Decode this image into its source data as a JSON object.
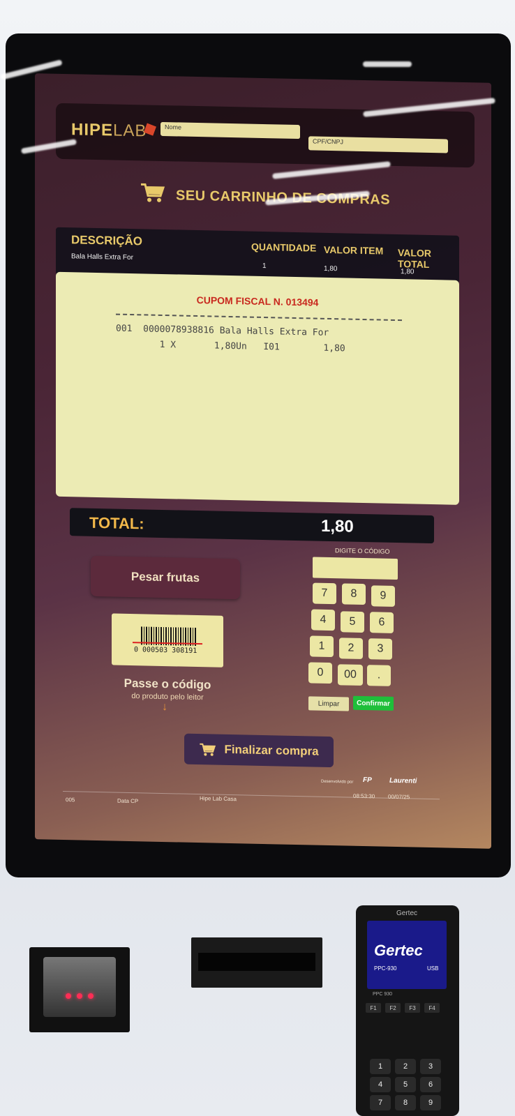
{
  "header": {
    "logo_main": "HIPE",
    "logo_sub": "LAB",
    "name_label": "Nome",
    "cpf_label": "CPF/CNPJ"
  },
  "cart": {
    "title": "SEU CARRINHO DE COMPRAS",
    "icon": "shopping-cart-icon"
  },
  "table": {
    "headers": {
      "description": "DESCRIÇÃO",
      "quantity": "QUANTIDADE",
      "item_value": "VALOR ITEM",
      "total_value": "VALOR TOTAL"
    },
    "row": {
      "description": "Bala Halls Extra For",
      "quantity": "1",
      "item_value": "1,80",
      "total_value": "1,80"
    }
  },
  "receipt": {
    "title": "CUPOM FISCAL N. 013494",
    "line1": "001  0000078938816 Bala Halls Extra For",
    "line2": "        1 X       1,80Un   I01        1,80"
  },
  "total": {
    "label": "TOTAL:",
    "value": "1,80"
  },
  "actions": {
    "pesar_label": "Pesar frutas",
    "barcode_number": "0 000503 308191",
    "scan_title": "Passe o código",
    "scan_subtitle": "do produto pelo leitor",
    "finalize_label": "Finalizar compra"
  },
  "keypad": {
    "label": "DIGITE O CÓDIGO",
    "keys": [
      "7",
      "8",
      "9",
      "4",
      "5",
      "6",
      "1",
      "2",
      "3",
      "0",
      "00",
      "."
    ],
    "clear_label": "Limpar",
    "confirm_label": "Confirmar"
  },
  "footer": {
    "developed_by": "Desenvolvido por",
    "brand1": "FP",
    "brand2": "Laurenti",
    "code": "005",
    "data_label": "Data CP",
    "store": "Hipe Lab Casa",
    "time": "08:53:30",
    "date": "00/07/25"
  },
  "pinpad": {
    "brand": "Gertec",
    "screen_logo": "Gertec",
    "model": "PPC-930",
    "model_small": "PPC 930",
    "usb": "USB",
    "fkeys": [
      "F1",
      "F2",
      "F3",
      "F4"
    ],
    "keys": [
      "1",
      "2",
      "3",
      "4",
      "5",
      "6",
      "7",
      "8",
      "9"
    ]
  },
  "colors": {
    "accent_yellow": "#e8c96a",
    "receipt_bg": "#ecebb4",
    "confirm_green": "#1fbf3a",
    "receipt_red": "#c8281e"
  }
}
